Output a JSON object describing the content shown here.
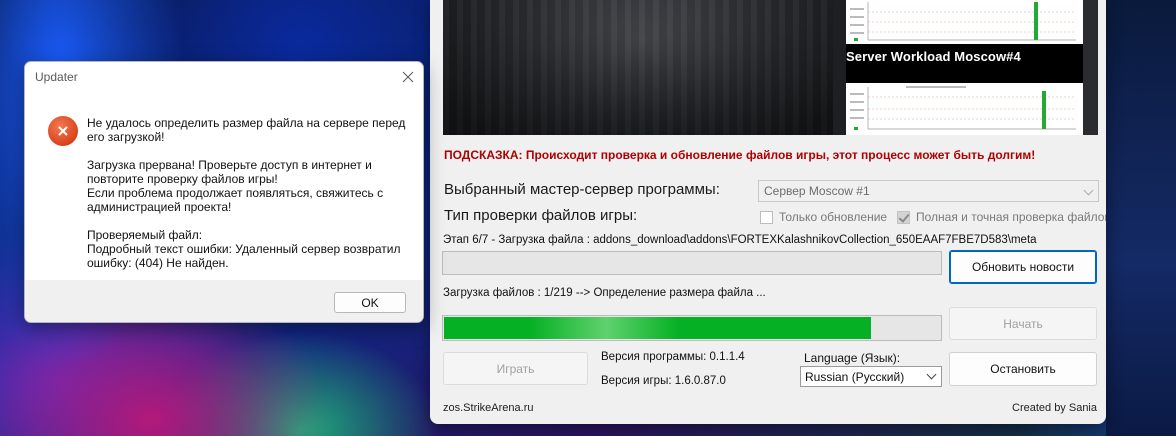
{
  "dialog": {
    "title": "Updater",
    "message_1": "Не удалось определить размер файла на сервере перед его загрузкой!",
    "message_2": "Загрузка прервана! Проверьте доступ в интернет и повторите проверку файлов игры!",
    "message_3": "Если проблема продолжает появляться, свяжитесь с администрацией проекта!",
    "file_label": "Проверяемый файл:",
    "error_text": "Подробный текст ошибки: Удаленный сервер возвратил ошибку: (404) Не найден.",
    "ok_label": "OK",
    "icon": "error-icon"
  },
  "launcher": {
    "banner": {
      "graph_title": "Server Workload Moscow#4"
    },
    "hint": "ПОДСКАЗКА: Происходит проверка и обновление файлов игры, этот процесс может быть долгим!",
    "master_server_label": "Выбранный мастер-сервер программы:",
    "master_server_value": "Сервер Moscow #1",
    "check_type_label": "Тип проверки файлов игры:",
    "check_only_update": "Только обновление",
    "check_full": "Полная и точная проверка файлов",
    "check_only_update_checked": false,
    "check_full_checked": true,
    "stage_text": "Этап 6/7 - Загрузка файла : addons_download\\addons\\FORTEXKalashnikovCollection_650EAAF7FBE7D583\\meta",
    "update_news_button": "Обновить новости",
    "files_text": "Загрузка файлов : 1/219  --> Определение размера файла ...",
    "progress_fraction": 0.86,
    "start_button": "Начать",
    "play_button": "Играть",
    "program_version": "Версия программы: 0.1.1.4",
    "game_version": "Версия игры: 1.6.0.87.0",
    "language_label": "Language (Язык):",
    "language_value": "Russian (Русский)",
    "stop_button": "Остановить",
    "footer_site": "zos.StrikeArena.ru",
    "footer_credit": "Created by Sania"
  },
  "colors": {
    "hint_red": "#b00000",
    "progress_green": "#06b025",
    "accent_blue": "#0067c0",
    "error_orange": "#d9431c"
  }
}
